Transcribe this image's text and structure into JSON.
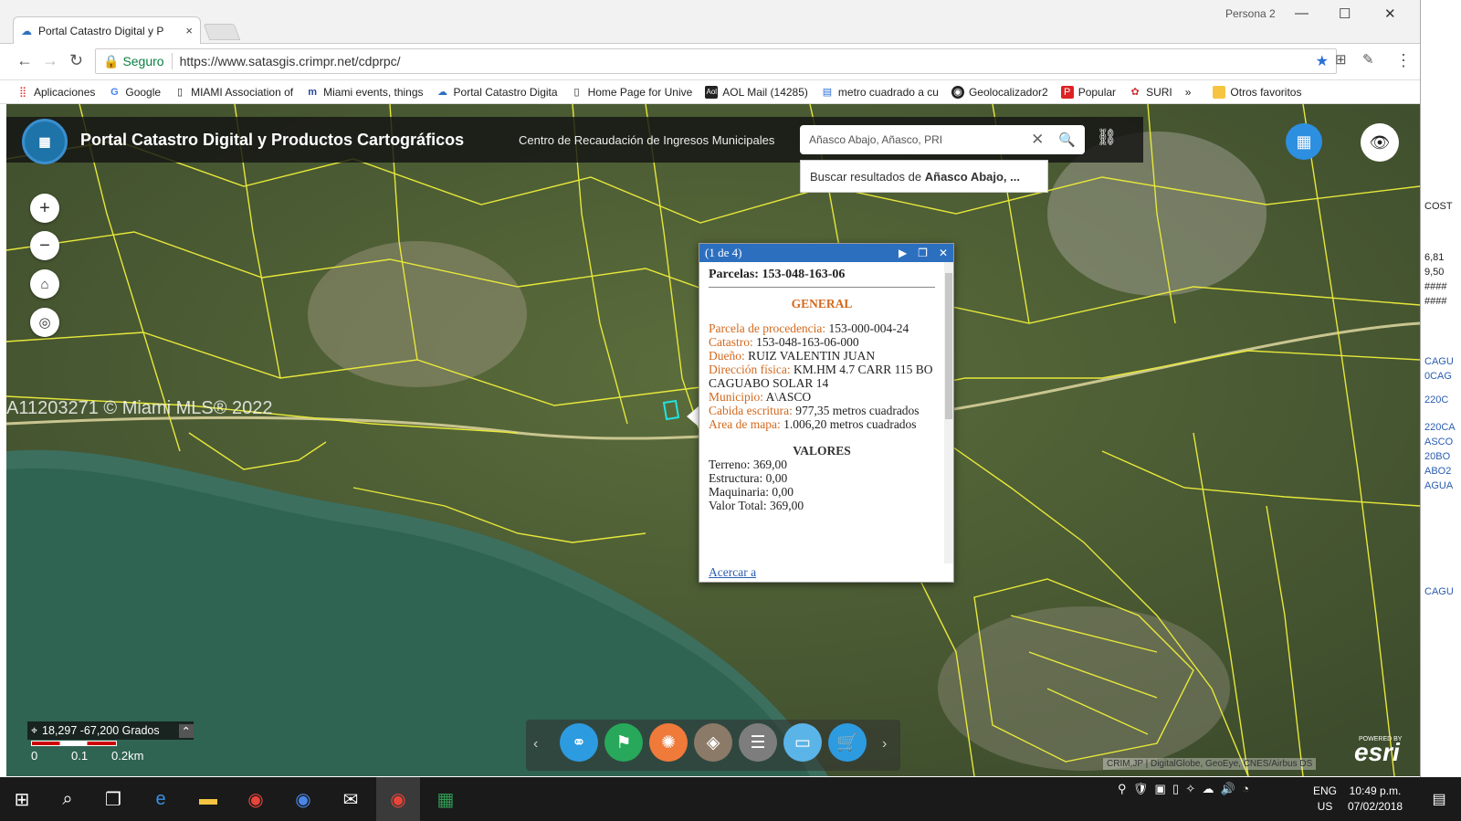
{
  "browser": {
    "tab_title": "Portal Catastro Digital y P",
    "profile": "Persona 2",
    "secure_label": "Seguro",
    "url": "https://www.satasgis.crimpr.net/cdprpc/",
    "bookmarks": [
      "Aplicaciones",
      "Google",
      "MIAMI Association of",
      "Miami events, things",
      "Portal Catastro Digita",
      "Home Page for Unive",
      "AOL Mail (14285)",
      "metro cuadrado a cu",
      "Geolocalizador2",
      "Popular",
      "SURI"
    ],
    "bookmarks_more": "»",
    "other_bookmarks": "Otros favoritos"
  },
  "app": {
    "title": "Portal Catastro Digital y Productos Cartográficos",
    "subtitle": "Centro de Recaudación de Ingresos Municipales",
    "search_value": "Añasco Abajo, Añasco, PRI",
    "suggestion_prefix": "Buscar resultados de ",
    "suggestion_bold": "Añasco Abajo, ..."
  },
  "map": {
    "watermark": "A11203271 © Miami MLS® 2022",
    "coords": "18,297 -67,200 Grados",
    "scale_labels": [
      "0",
      "0.1",
      "0.2km"
    ],
    "attribution": "CRIM,JP | DigitalGlobe, GeoEye, CNES/Airbus DS",
    "esri_powered": "POWERED BY",
    "esri": "esri"
  },
  "popup": {
    "counter": "(1 de 4)",
    "title": "Parcelas: 153-048-163-06",
    "section_general": "GENERAL",
    "fields": [
      {
        "k": "Parcela de procedencia:",
        "v": " 153-000-004-24"
      },
      {
        "k": "Catastro:",
        "v": " 153-048-163-06-000"
      },
      {
        "k": "Dueño:",
        "v": " RUIZ VALENTIN JUAN"
      },
      {
        "k": "Dirección física:",
        "v": " KM.HM 4.7 CARR 115 BO CAGUABO SOLAR 14"
      },
      {
        "k": "Municipio:",
        "v": " A\\ASCO"
      },
      {
        "k": "Cabida escritura:",
        "v": " 977,35 metros cuadrados"
      },
      {
        "k": "Area de mapa:",
        "v": " 1.006,20 metros cuadrados"
      }
    ],
    "section_valores": "VALORES",
    "valores": [
      "Terreno: 369,00",
      "Estructura: 0,00",
      "Maquinaria: 0,00",
      "Valor Total: 369,00"
    ],
    "zoom_link": "Acercar a"
  },
  "taskbar": {
    "lang": "ENG",
    "region": "US",
    "time": "10:49 p.m.",
    "date": "07/02/2018"
  },
  "right_window": [
    "COST",
    "6,81",
    "9,50",
    "####",
    "####",
    "CAGU",
    "0CAG",
    "220C",
    "220CA",
    "ASCO",
    "20BO",
    "ABO2",
    "AGUA",
    "CAGU"
  ]
}
